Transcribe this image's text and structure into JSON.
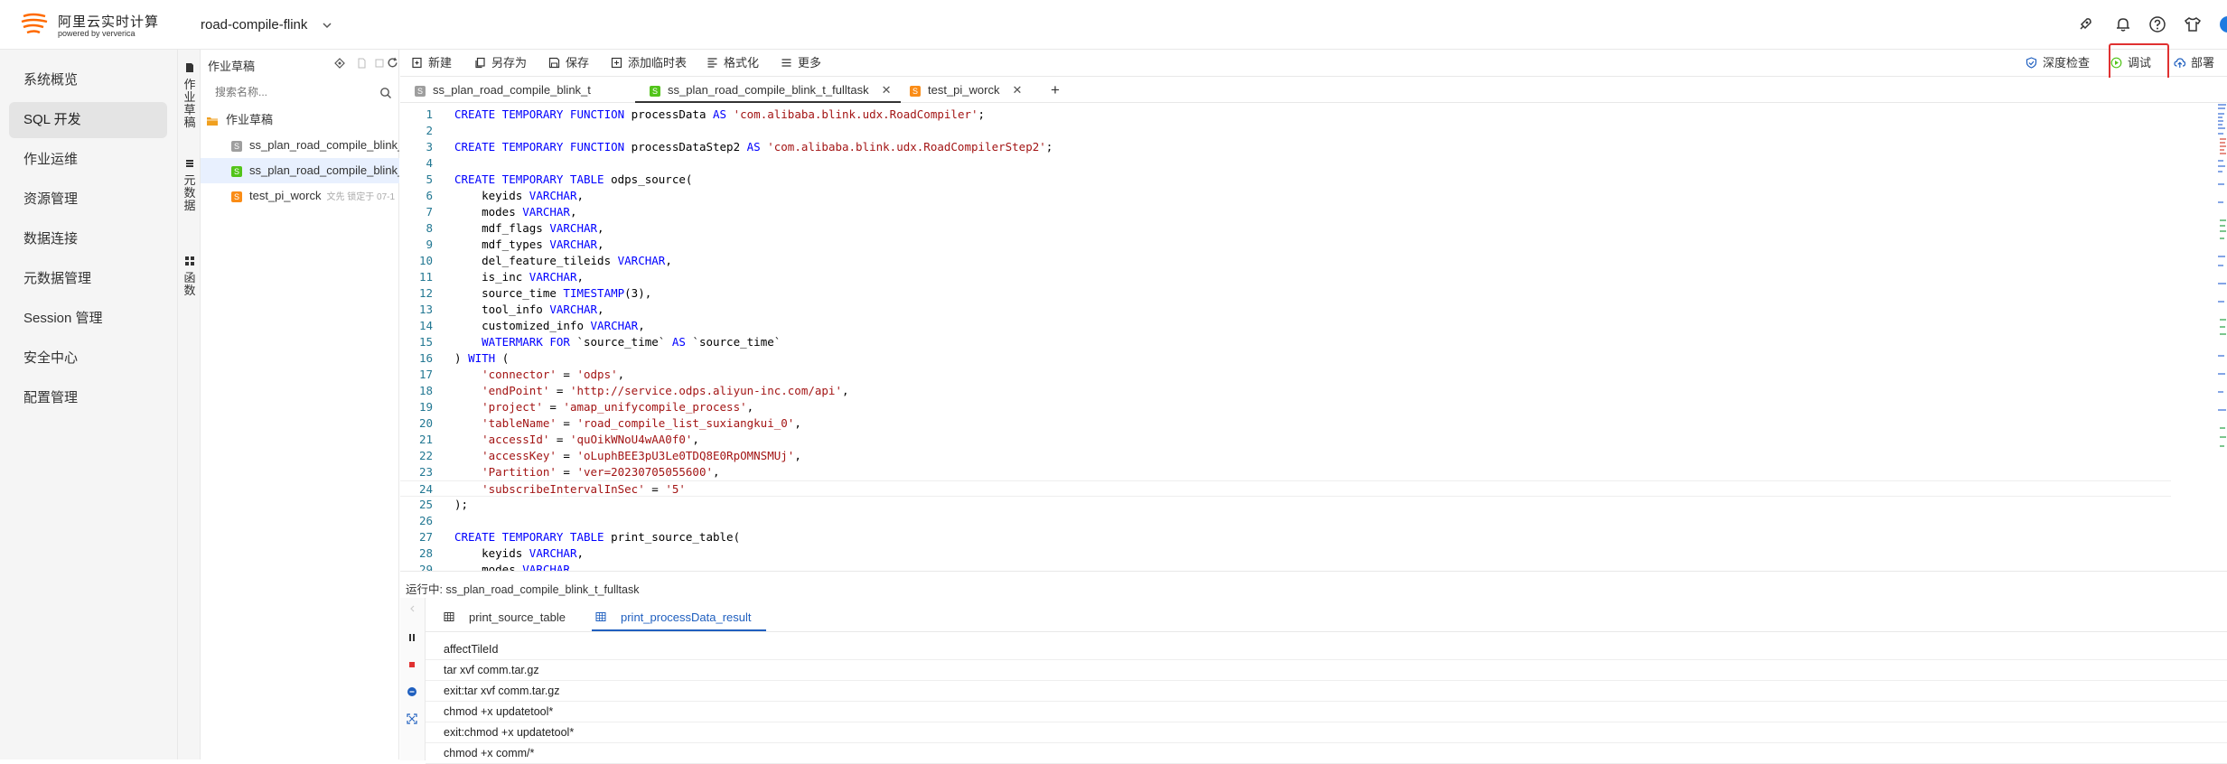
{
  "header": {
    "brand_title": "阿里云实时计算",
    "brand_sub": "powered by ververica",
    "project_name": "road-compile-flink"
  },
  "nav": {
    "items": [
      {
        "label": "系统概览"
      },
      {
        "label": "SQL 开发"
      },
      {
        "label": "作业运维"
      },
      {
        "label": "资源管理"
      },
      {
        "label": "数据连接"
      },
      {
        "label": "元数据管理"
      },
      {
        "label": "Session 管理"
      },
      {
        "label": "安全中心"
      },
      {
        "label": "配置管理"
      }
    ],
    "active_index": 1
  },
  "vtabs": [
    "作业草稿",
    "元数据",
    "函数"
  ],
  "drafts": {
    "title": "作业草稿",
    "search_placeholder": "搜索名称...",
    "folder": "作业草稿",
    "files": [
      {
        "name": "ss_plan_road_compile_blink_t",
        "badge": "S",
        "badge_color": "#9e9e9e",
        "meta": ""
      },
      {
        "name": "ss_plan_road_compile_blink_",
        "badge": "S",
        "badge_color": "#52c41a",
        "meta": ""
      },
      {
        "name": "test_pi_worck",
        "badge": "S",
        "badge_color": "#fa8c16",
        "meta": "文先 锁定于 07-1"
      }
    ],
    "selected_index": 1
  },
  "toolbar": {
    "new": "新建",
    "save_as": "另存为",
    "save": "保存",
    "add_temp_table": "添加临时表",
    "format": "格式化",
    "more": "更多",
    "deep_check": "深度检查",
    "debug": "调试",
    "deploy": "部署"
  },
  "file_tabs": [
    {
      "label": "ss_plan_road_compile_blink_t",
      "badge": "S",
      "badge_color": "#9e9e9e",
      "closable": false
    },
    {
      "label": "ss_plan_road_compile_blink_t_fulltask",
      "badge": "S",
      "badge_color": "#52c41a",
      "closable": true
    },
    {
      "label": "test_pi_worck",
      "badge": "S",
      "badge_color": "#fa8c16",
      "closable": true
    }
  ],
  "active_file_tab": 1,
  "editor": {
    "current_line": 24,
    "lines": [
      [
        [
          "kw",
          "CREATE TEMPORARY FUNCTION"
        ],
        [
          "p",
          " processData "
        ],
        [
          "kw",
          "AS"
        ],
        [
          "p",
          " "
        ],
        [
          "str",
          "'com.alibaba.blink.udx.RoadCompiler'"
        ],
        [
          "p",
          ";"
        ]
      ],
      [],
      [
        [
          "kw",
          "CREATE TEMPORARY FUNCTION"
        ],
        [
          "p",
          " processDataStep2 "
        ],
        [
          "kw",
          "AS"
        ],
        [
          "p",
          " "
        ],
        [
          "str",
          "'com.alibaba.blink.udx.RoadCompilerStep2'"
        ],
        [
          "p",
          ";"
        ]
      ],
      [],
      [
        [
          "kw",
          "CREATE TEMPORARY TABLE"
        ],
        [
          "p",
          " odps_source("
        ]
      ],
      [
        [
          "p",
          "    keyids "
        ],
        [
          "kw",
          "VARCHAR"
        ],
        [
          "p",
          ","
        ]
      ],
      [
        [
          "p",
          "    modes "
        ],
        [
          "kw",
          "VARCHAR"
        ],
        [
          "p",
          ","
        ]
      ],
      [
        [
          "p",
          "    mdf_flags "
        ],
        [
          "kw",
          "VARCHAR"
        ],
        [
          "p",
          ","
        ]
      ],
      [
        [
          "p",
          "    mdf_types "
        ],
        [
          "kw",
          "VARCHAR"
        ],
        [
          "p",
          ","
        ]
      ],
      [
        [
          "p",
          "    del_feature_tileids "
        ],
        [
          "kw",
          "VARCHAR"
        ],
        [
          "p",
          ","
        ]
      ],
      [
        [
          "p",
          "    is_inc "
        ],
        [
          "kw",
          "VARCHAR"
        ],
        [
          "p",
          ","
        ]
      ],
      [
        [
          "p",
          "    source_time "
        ],
        [
          "kw",
          "TIMESTAMP"
        ],
        [
          "p",
          "(3),"
        ]
      ],
      [
        [
          "p",
          "    tool_info "
        ],
        [
          "kw",
          "VARCHAR"
        ],
        [
          "p",
          ","
        ]
      ],
      [
        [
          "p",
          "    customized_info "
        ],
        [
          "kw",
          "VARCHAR"
        ],
        [
          "p",
          ","
        ]
      ],
      [
        [
          "p",
          "    "
        ],
        [
          "kw",
          "WATERMARK FOR"
        ],
        [
          "p",
          " `source_time` "
        ],
        [
          "kw",
          "AS"
        ],
        [
          "p",
          " `source_time`"
        ]
      ],
      [
        [
          "p",
          ") "
        ],
        [
          "kw",
          "WITH"
        ],
        [
          "p",
          " ("
        ]
      ],
      [
        [
          "p",
          "    "
        ],
        [
          "str",
          "'connector'"
        ],
        [
          "p",
          " = "
        ],
        [
          "str",
          "'odps'"
        ],
        [
          "p",
          ","
        ]
      ],
      [
        [
          "p",
          "    "
        ],
        [
          "str",
          "'endPoint'"
        ],
        [
          "p",
          " = "
        ],
        [
          "str",
          "'http://service.odps.aliyun-inc.com/api'"
        ],
        [
          "p",
          ","
        ]
      ],
      [
        [
          "p",
          "    "
        ],
        [
          "str",
          "'project'"
        ],
        [
          "p",
          " = "
        ],
        [
          "str",
          "'amap_unifycompile_process'"
        ],
        [
          "p",
          ","
        ]
      ],
      [
        [
          "p",
          "    "
        ],
        [
          "str",
          "'tableName'"
        ],
        [
          "p",
          " = "
        ],
        [
          "str",
          "'road_compile_list_suxiangkui_0'"
        ],
        [
          "p",
          ","
        ]
      ],
      [
        [
          "p",
          "    "
        ],
        [
          "str",
          "'accessId'"
        ],
        [
          "p",
          " = "
        ],
        [
          "str",
          "'quOikWNoU4wAA0f0'"
        ],
        [
          "p",
          ","
        ]
      ],
      [
        [
          "p",
          "    "
        ],
        [
          "str",
          "'accessKey'"
        ],
        [
          "p",
          " = "
        ],
        [
          "str",
          "'oLuphBEE3pU3Le0TDQ8E0RpOMNSMUj'"
        ],
        [
          "p",
          ","
        ]
      ],
      [
        [
          "p",
          "    "
        ],
        [
          "str",
          "'Partition'"
        ],
        [
          "p",
          " = "
        ],
        [
          "str",
          "'ver=20230705055600'"
        ],
        [
          "p",
          ","
        ]
      ],
      [
        [
          "p",
          "    "
        ],
        [
          "str",
          "'subscribeIntervalInSec'"
        ],
        [
          "p",
          " = "
        ],
        [
          "str",
          "'5'"
        ]
      ],
      [
        [
          "p",
          ");"
        ]
      ],
      [],
      [
        [
          "kw",
          "CREATE TEMPORARY TABLE"
        ],
        [
          "p",
          " print_source_table("
        ]
      ],
      [
        [
          "p",
          "    keyids "
        ],
        [
          "kw",
          "VARCHAR"
        ],
        [
          "p",
          ","
        ]
      ],
      [
        [
          "p",
          "    modes "
        ],
        [
          "kw",
          "VARCHAR"
        ]
      ]
    ]
  },
  "results": {
    "running_label": "运行中: ss_plan_road_compile_blink_t_fulltask",
    "tabs": [
      "print_source_table",
      "print_processData_result"
    ],
    "active_tab": 1,
    "rows": [
      "affectTileId",
      "tar xvf comm.tar.gz",
      "exit:tar xvf comm.tar.gz",
      "chmod +x updatetool*",
      "exit:chmod +x updatetool*",
      "chmod +x comm/*"
    ]
  },
  "colors": {
    "accent": "#1f5fbf",
    "highlight_box": "#e03131",
    "brand_orange": "#ff6a00"
  }
}
